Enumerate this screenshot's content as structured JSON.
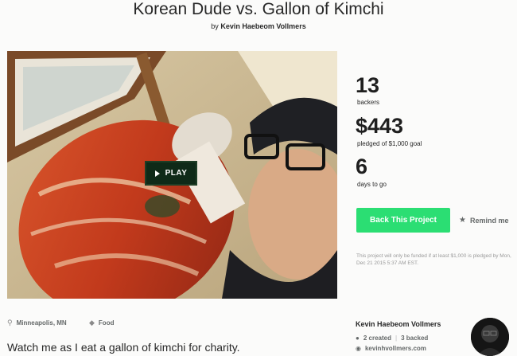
{
  "project": {
    "title": "Korean Dude vs. Gallon of Kimchi",
    "by_prefix": "by",
    "creator": "Kevin Haebeom Vollmers"
  },
  "video": {
    "play_label": "PLAY"
  },
  "stats": {
    "backers_count": "13",
    "backers_label": "backers",
    "pledged_amount": "$443",
    "pledged_label": "pledged of $1,000 goal",
    "days_count": "6",
    "days_label": "days to go"
  },
  "actions": {
    "back_label": "Back This Project",
    "remind_label": "Remind me",
    "back_color": "#2bde73"
  },
  "funding_note": "This project will only be funded if at least $1,000 is pledged by Mon, Dec 21 2015 5:37 AM EST.",
  "meta": {
    "location": "Minneapolis, MN",
    "category": "Food"
  },
  "blurb": "Watch me as I eat a gallon of kimchi for charity.",
  "creator_card": {
    "name": "Kevin Haebeom Vollmers",
    "created": "2 created",
    "backed": "3 backed",
    "website": "kevinhvollmers.com"
  }
}
